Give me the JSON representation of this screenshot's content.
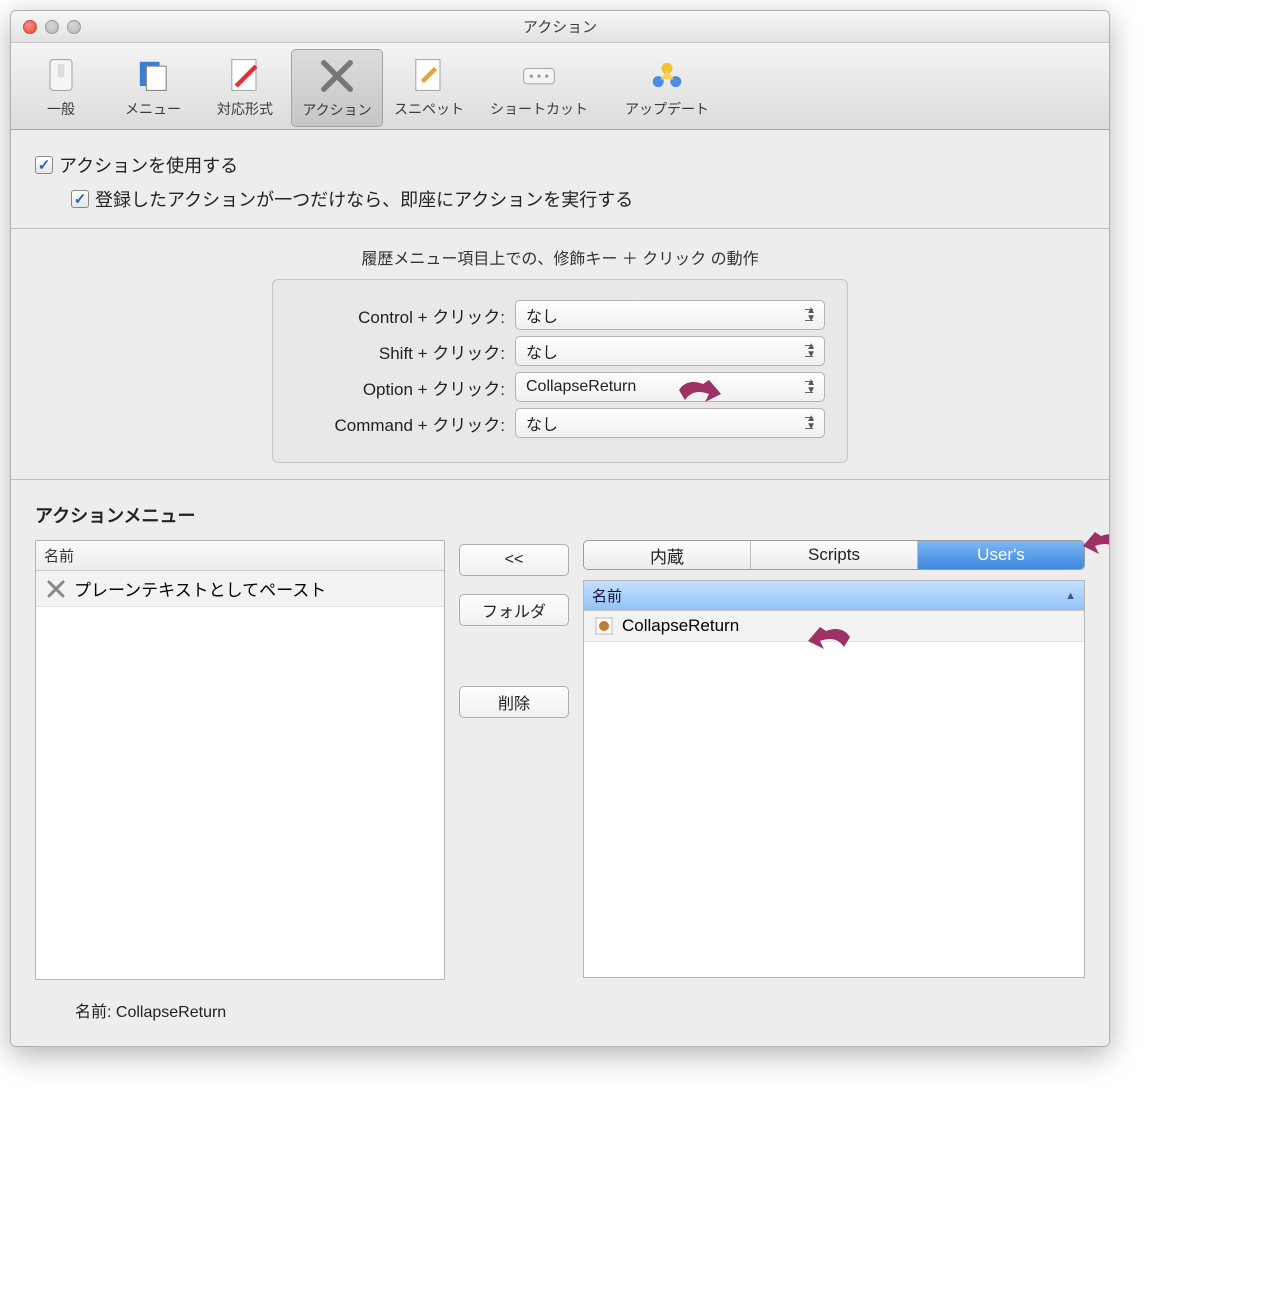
{
  "window": {
    "title": "アクション"
  },
  "toolbar": {
    "items": [
      {
        "label": "一般"
      },
      {
        "label": "メニュー"
      },
      {
        "label": "対応形式"
      },
      {
        "label": "アクション"
      },
      {
        "label": "スニペット"
      },
      {
        "label": "ショートカット"
      },
      {
        "label": "アップデート"
      }
    ],
    "selected_index": 3
  },
  "checkboxes": {
    "use_actions": "アクションを使用する",
    "run_if_single": "登録したアクションが一つだけなら、即座にアクションを実行する"
  },
  "modifiers": {
    "help": "履歴メニュー項目上での、修飾キー ＋ クリック の動作",
    "rows": [
      {
        "label": "Control + クリック:",
        "value": "なし"
      },
      {
        "label": "Shift + クリック:",
        "value": "なし"
      },
      {
        "label": "Option + クリック:",
        "value": "CollapseReturn"
      },
      {
        "label": "Command + クリック:",
        "value": "なし"
      }
    ]
  },
  "action_menu": {
    "title": "アクションメニュー",
    "name_column": "名前",
    "left_items": [
      {
        "label": "プレーンテキストとしてペースト"
      }
    ],
    "buttons": {
      "add": "<<",
      "folder": "フォルダ",
      "delete": "削除"
    },
    "tabs": [
      {
        "label": "内蔵"
      },
      {
        "label": "Scripts"
      },
      {
        "label": "User's"
      }
    ],
    "active_tab": 2,
    "right_items": [
      {
        "label": "CollapseReturn"
      }
    ],
    "footer_label": "名前:",
    "footer_value": "CollapseReturn"
  }
}
